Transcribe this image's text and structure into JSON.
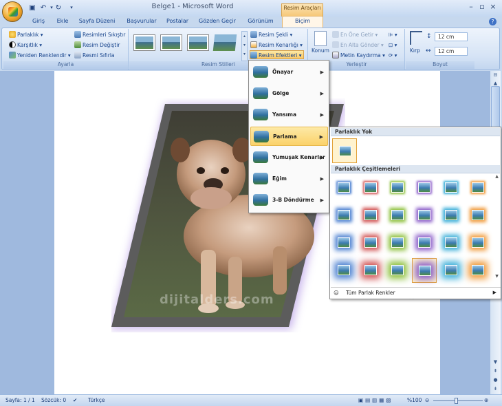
{
  "window": {
    "title": "Belge1 - Microsoft Word",
    "context_group": "Resim Araçları"
  },
  "tabs": [
    "Giriş",
    "Ekle",
    "Sayfa Düzeni",
    "Başvurular",
    "Postalar",
    "Gözden Geçir",
    "Görünüm",
    "Biçim"
  ],
  "active_tab": "Biçim",
  "ribbon": {
    "ayarla": {
      "label": "Ayarla",
      "items": [
        "Parlaklık",
        "Karşıtlık",
        "Yeniden Renklendir",
        "Resimleri Sıkıştır",
        "Resim Değiştir",
        "Resmi Sıfırla"
      ]
    },
    "resim_stilleri": {
      "label": "Resim Stilleri",
      "items": [
        "Resim Şekli",
        "Resim Kenarlığı",
        "Resim Efektleri"
      ]
    },
    "yerlestir": {
      "label": "Yerleştir",
      "konum": "Konum",
      "items": [
        "En Öne Getir",
        "En Alta Gönder",
        "Metin Kaydırma"
      ]
    },
    "boyut": {
      "label": "Boyut",
      "kirp": "Kırp",
      "height": "12 cm",
      "width": "12 cm"
    }
  },
  "menu": {
    "items": [
      "Önayar",
      "Gölge",
      "Yansıma",
      "Parlama",
      "Yumuşak Kenarlar",
      "Eğim",
      "3-B Döndürme"
    ],
    "highlighted": "Parlama"
  },
  "gallery": {
    "header_none": "Parlaklık Yok",
    "header_variations": "Parlaklık Çeşitlemeleri",
    "colors": [
      "#4a7fd0",
      "#d05050",
      "#8cbf3a",
      "#8a5cc8",
      "#3aaed8",
      "#f09a3a"
    ],
    "selected": {
      "row": 3,
      "col": 3
    },
    "footer": "Tüm Parlak Renkler"
  },
  "watermark": "dijitalders.com",
  "status": {
    "page": "Sayfa: 1 / 1",
    "words": "Sözcük: 0",
    "language": "Türkçe",
    "zoom": "%100"
  }
}
